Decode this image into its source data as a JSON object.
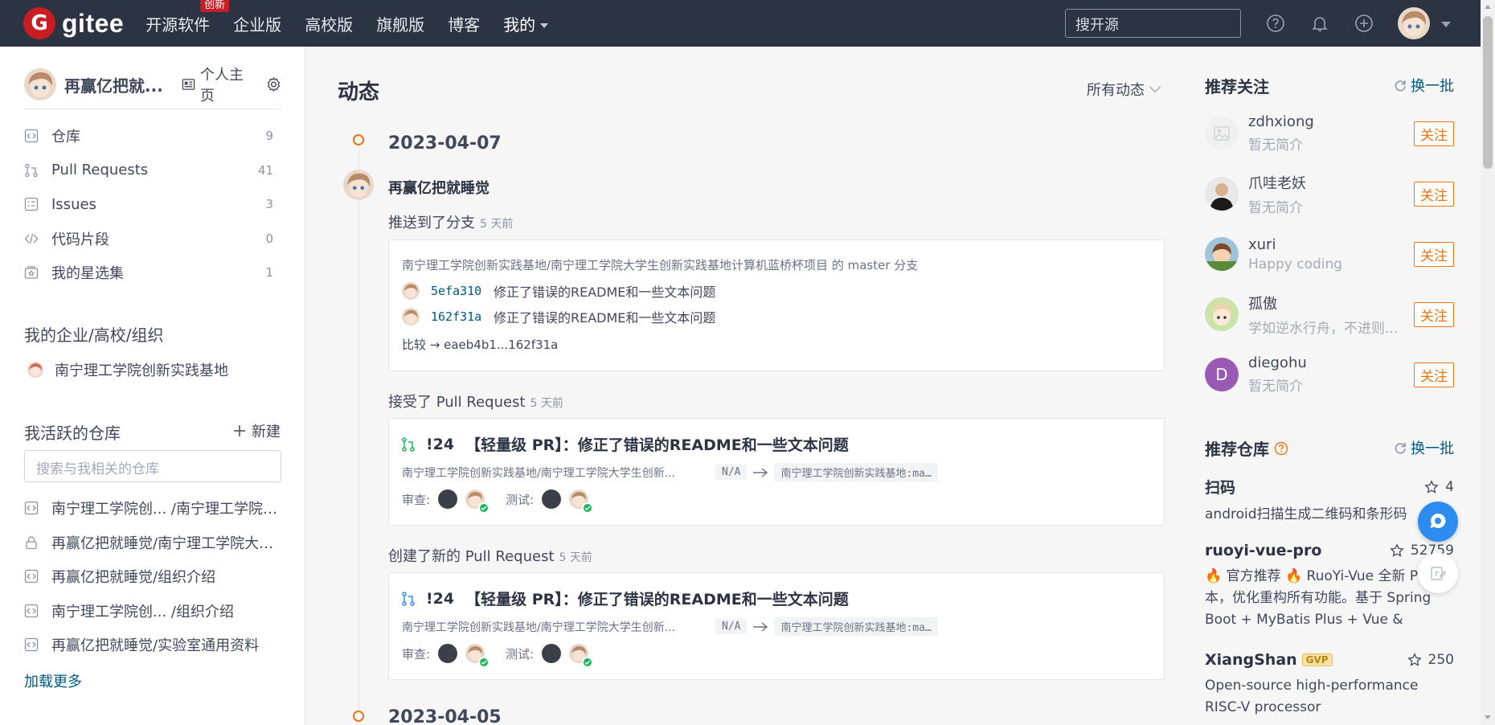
{
  "header": {
    "logo_text": "gitee",
    "nav": [
      {
        "label": "开源软件",
        "badge": "创新"
      },
      {
        "label": "企业版"
      },
      {
        "label": "高校版"
      },
      {
        "label": "旗舰版"
      },
      {
        "label": "博客"
      },
      {
        "label": "我的"
      }
    ],
    "search_placeholder": "搜开源",
    "icons": [
      "help-icon",
      "bell-icon",
      "plus-icon",
      "avatar",
      "caret-down-icon"
    ]
  },
  "sidebar": {
    "user_name": "再赢亿把就...",
    "home_label": "个人主页",
    "menu": [
      {
        "label": "仓库",
        "count": "9",
        "icon": "repo-icon"
      },
      {
        "label": "Pull Requests",
        "count": "41",
        "icon": "pull-request-icon"
      },
      {
        "label": "Issues",
        "count": "3",
        "icon": "issues-icon"
      },
      {
        "label": "代码片段",
        "count": "0",
        "icon": "code-icon"
      },
      {
        "label": "我的星选集",
        "count": "1",
        "icon": "star-collection-icon"
      }
    ],
    "org_section_title": "我的企业/高校/组织",
    "org_item": "南宁理工学院创新实践基地",
    "active_repos_title": "我活跃的仓库",
    "new_label": "新建",
    "repo_search_placeholder": "搜索与我相关的仓库",
    "repos": [
      {
        "label": "南宁理工学院创... /南宁理工学院大...",
        "icon": "repo-icon"
      },
      {
        "label": "再赢亿把就睡觉/南宁理工学院大学...",
        "icon": "lock-icon"
      },
      {
        "label": "再赢亿把就睡觉/组织介绍",
        "icon": "repo-icon"
      },
      {
        "label": "南宁理工学院创... /组织介绍",
        "icon": "repo-icon"
      },
      {
        "label": "再赢亿把就睡觉/实验室通用资料",
        "icon": "repo-icon"
      }
    ],
    "load_more": "加载更多"
  },
  "feed": {
    "title": "动态",
    "filter": "所有动态",
    "date1": "2023-04-07",
    "user": "再赢亿把就睡觉",
    "event1": {
      "title": "推送到了分支",
      "time": "5 天前"
    },
    "push_card": {
      "branch_line": "南宁理工学院创新实践基地/南宁理工学院大学生创新实践基地计算机蓝桥杯项目 的 master 分支",
      "commits": [
        {
          "sha": "5efa310",
          "message": "修正了错误的README和一些文本问题"
        },
        {
          "sha": "162f31a",
          "message": "修正了错误的README和一些文本问题"
        }
      ],
      "compare": "比较 → eaeb4b1...162f31a"
    },
    "event2": {
      "title": "接受了 Pull Request",
      "time": "5 天前"
    },
    "pr1": {
      "number": "!24",
      "title": "【轻量级 PR】：修正了错误的README和一些文本问题",
      "from": "南宁理工学院创新实践基地/南宁理工学院大学生创新...",
      "from_branch": "N/A",
      "to_branch": "南宁理工学院创新实践基地:ma…",
      "reviewer_label": "审查:",
      "tester_label": "测试:"
    },
    "event3": {
      "title": "创建了新的 Pull Request",
      "time": "5 天前"
    },
    "pr2": {
      "number": "!24",
      "title": "【轻量级 PR】：修正了错误的README和一些文本问题",
      "from": "南宁理工学院创新实践基地/南宁理工学院大学生创新...",
      "from_branch": "N/A",
      "to_branch": "南宁理工学院创新实践基地:ma…",
      "reviewer_label": "审查:",
      "tester_label": "测试:"
    },
    "date2": "2023-04-05"
  },
  "right": {
    "follow_title": "推荐关注",
    "refresh_label": "换一批",
    "follow_button": "关注",
    "follows": [
      {
        "name": "zdhxiong",
        "desc": "暂无简介"
      },
      {
        "name": "爪哇老妖",
        "desc": "暂无简介"
      },
      {
        "name": "xuri",
        "desc": "Happy coding"
      },
      {
        "name": "孤傲",
        "desc": "学如逆水行舟，不进则..."
      },
      {
        "name": "diegohu",
        "desc": "暂无简介",
        "initial": "D"
      }
    ],
    "repo_title": "推荐仓库",
    "repos": [
      {
        "name": "扫码",
        "stars": "4",
        "desc": "android扫描生成二维码和条形码"
      },
      {
        "name": "ruoyi-vue-pro",
        "stars": "52759",
        "desc": "🔥 官方推荐 🔥 RuoYi-Vue 全新 Pro 版本，优化重构所有功能。基于 Spring Boot + MyBatis Plus + Vue & Element..."
      },
      {
        "name": "XiangShan",
        "badge": "GVP",
        "stars": "250",
        "desc": "Open-source high-performance RISC-V processor"
      }
    ]
  },
  "colors": {
    "header_bg": "#2c3444",
    "brand_red": "#c71d23",
    "accent_orange": "#ea7414",
    "link_blue": "#005980",
    "success_green": "#1ab659"
  }
}
